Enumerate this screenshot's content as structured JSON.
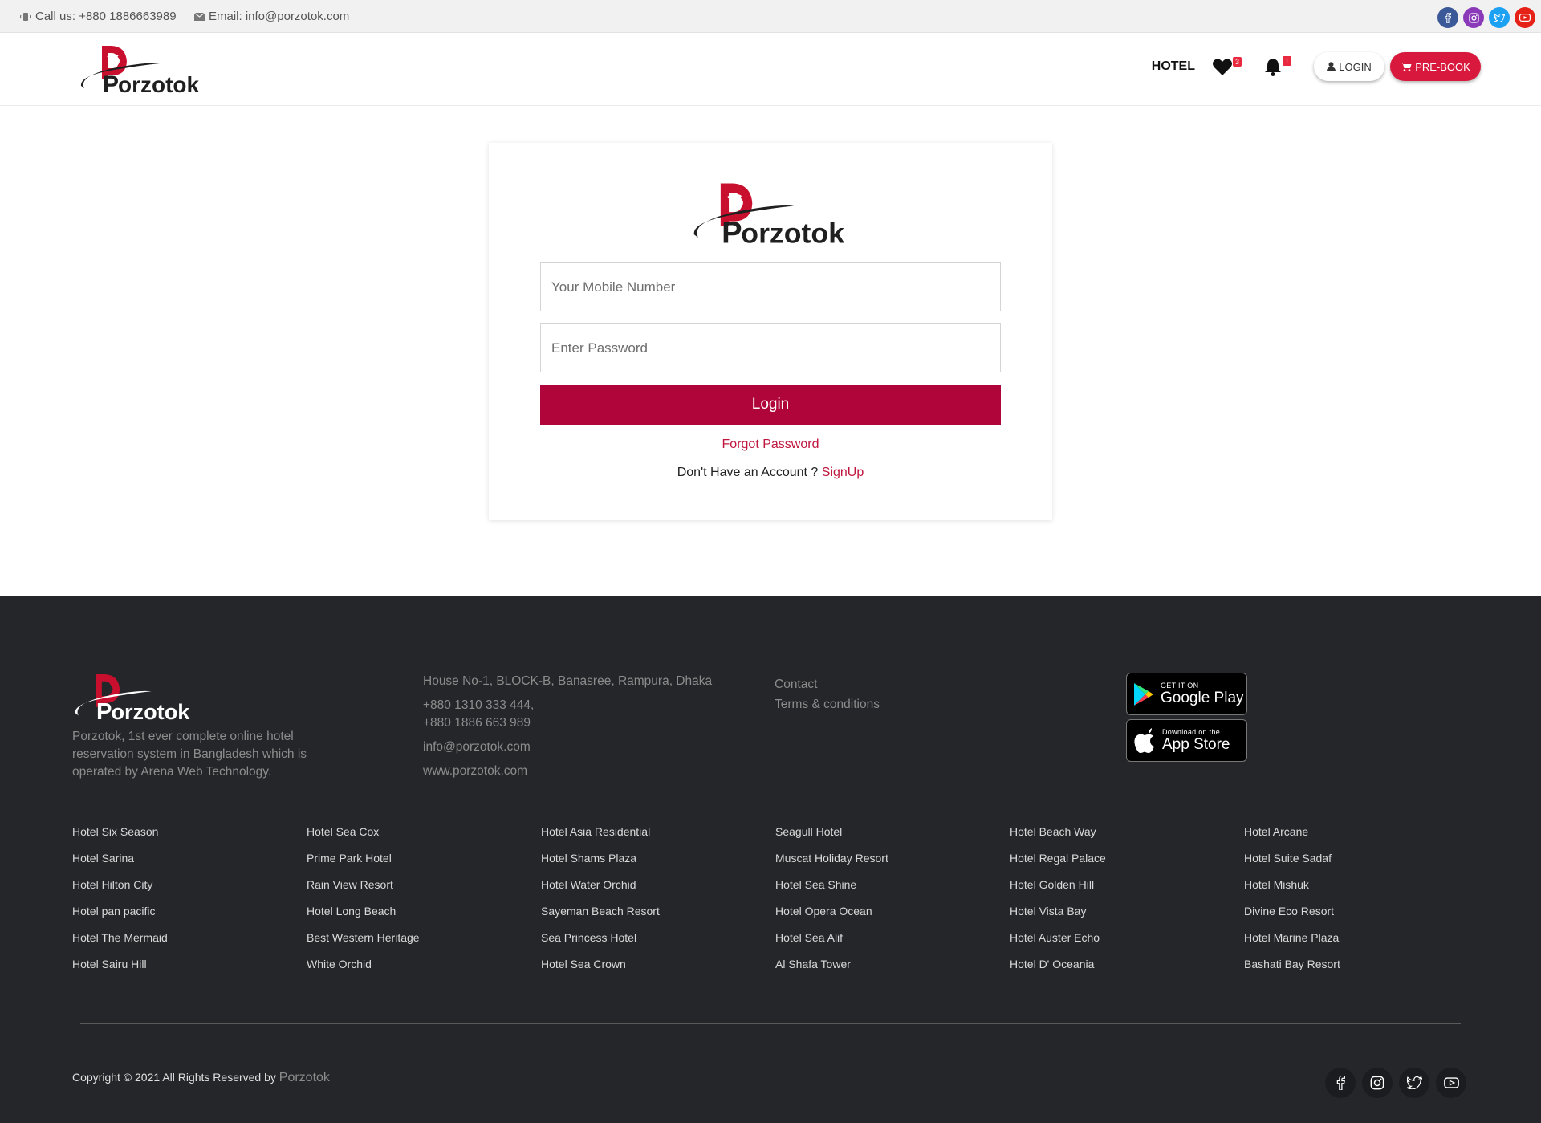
{
  "topbar": {
    "call": "Call us: +880 1886663989",
    "email": "Email: info@porzotok.com",
    "socials": [
      {
        "icon": "facebook-icon",
        "color": "#3b5998"
      },
      {
        "icon": "instagram-icon",
        "color": "#8a3ab9"
      },
      {
        "icon": "twitter-icon",
        "color": "#1da1f2"
      },
      {
        "icon": "youtube-icon",
        "color": "#e62117"
      }
    ]
  },
  "brand": {
    "logo_text": "orzotok",
    "logo_initial": "P",
    "accent": "#b0053a"
  },
  "header": {
    "nav_hotel": "HOTEL",
    "wishlist_count": "3",
    "notification_count": "1",
    "login_label": "LOGIN",
    "prebook_label": "PRE-BOOK"
  },
  "login": {
    "mobile_placeholder": "Your Mobile Number",
    "password_placeholder": "Enter Password",
    "submit_label": "Login",
    "forgot_label": "Forgot Password",
    "no_account_text": "Don't Have an Account ?",
    "signup_label": "SignUp"
  },
  "footer": {
    "about": "Porzotok, 1st ever complete online hotel reservation system in Bangladesh which is operated by Arena Web Technology.",
    "address": "House No-1, BLOCK-B, Banasree, Rampura, Dhaka",
    "phone1": "+880 1310 333 444,",
    "phone2": "+880 1886 663 989",
    "email": "info@porzotok.com",
    "website": "www.porzotok.com",
    "links": [
      "Contact",
      "Terms & conditions"
    ],
    "google_play": {
      "line1": "GET IT ON",
      "line2": "Google Play"
    },
    "app_store": {
      "line1": "Download on the",
      "line2": "App Store"
    },
    "hotel_columns": [
      [
        "Hotel Six Season",
        "Hotel Sarina",
        "Hotel Hilton City",
        "Hotel pan pacific",
        "Hotel The Mermaid",
        "Hotel Sairu Hill"
      ],
      [
        "Hotel Sea Cox",
        "Prime Park Hotel",
        "Rain View Resort",
        "Hotel Long Beach",
        "Best Western Heritage",
        "White Orchid"
      ],
      [
        "Hotel Asia Residential",
        "Hotel Shams Plaza",
        "Hotel Water Orchid",
        "Sayeman Beach Resort",
        "Sea Princess Hotel",
        "Hotel Sea Crown"
      ],
      [
        "Seagull Hotel",
        "Muscat Holiday Resort",
        "Hotel Sea Shine",
        "Hotel Opera Ocean",
        "Hotel Sea Alif",
        "Al Shafa Tower"
      ],
      [
        "Hotel Beach Way",
        "Hotel Regal Palace",
        "Hotel Golden Hill",
        "Hotel Vista Bay",
        "Hotel Auster Echo",
        "Hotel D' Oceania"
      ],
      [
        "Hotel Arcane",
        "Hotel Suite Sadaf",
        "Hotel Mishuk",
        "Divine Eco Resort",
        "Hotel Marine Plaza",
        "Bashati Bay Resort"
      ]
    ],
    "copyright": "Copyright © 2021 All Rights Reserved by",
    "copyright_brand": "Porzotok",
    "socials": [
      "facebook-icon",
      "instagram-icon",
      "twitter-icon",
      "youtube-icon"
    ]
  }
}
